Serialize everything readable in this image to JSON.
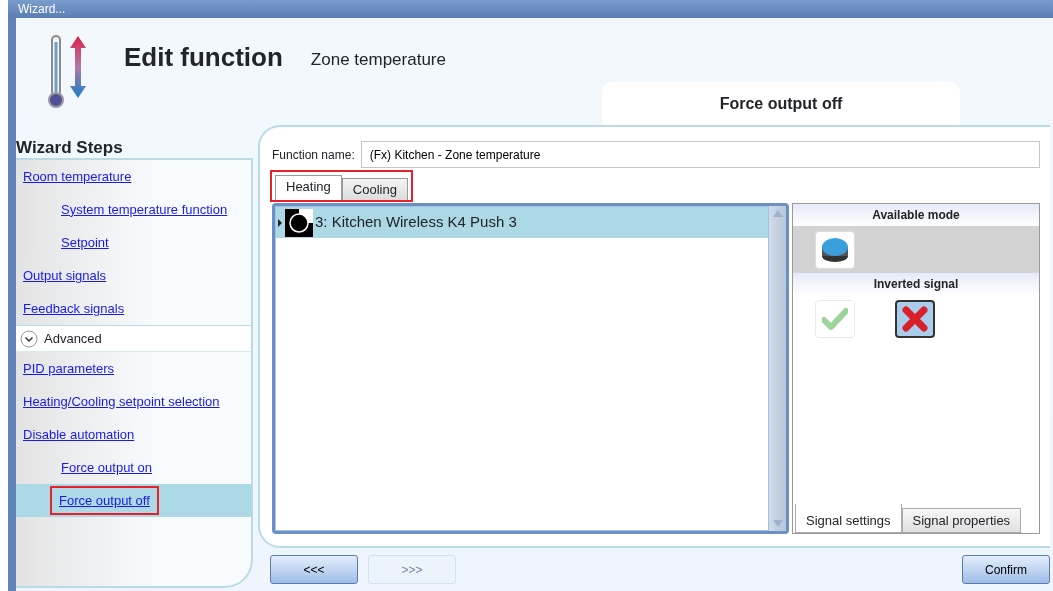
{
  "window": {
    "title": "Wizard..."
  },
  "header": {
    "title": "Edit function",
    "subtitle": "Zone temperature",
    "step_title": "Force output off"
  },
  "wizard_steps": {
    "heading": "Wizard Steps",
    "items": [
      {
        "label": "Room temperature",
        "selected": false,
        "children": [
          {
            "label": "System temperature function",
            "selected": false
          },
          {
            "label": "Setpoint",
            "selected": false
          }
        ]
      },
      {
        "label": "Output signals",
        "selected": false
      },
      {
        "label": "Feedback signals",
        "selected": false
      }
    ],
    "advanced": {
      "label": "Advanced",
      "expanded": true,
      "items": [
        {
          "label": "PID parameters",
          "selected": false
        },
        {
          "label": "Heating/Cooling setpoint selection",
          "selected": false
        },
        {
          "label": "Disable automation",
          "selected": false,
          "children": [
            {
              "label": "Force output on",
              "selected": false
            },
            {
              "label": "Force output off",
              "selected": true,
              "highlighted": true
            }
          ]
        }
      ]
    }
  },
  "function_name": {
    "label": "Function name:",
    "value": "(Fx) Kitchen - Zone temperature"
  },
  "tabs": {
    "highlighted": true,
    "items": [
      {
        "label": "Heating",
        "selected": true
      },
      {
        "label": "Cooling",
        "selected": false
      }
    ]
  },
  "signals": [
    {
      "label": "3: Kitchen Wireless K4 Push 3",
      "selected": true
    }
  ],
  "signal_panel": {
    "available_mode": {
      "heading": "Available mode",
      "options": [
        {
          "kind": "push-button",
          "selected": true
        }
      ]
    },
    "inverted_signal": {
      "heading": "Inverted signal",
      "options": [
        {
          "kind": "yes",
          "selected": false
        },
        {
          "kind": "no",
          "selected": true
        }
      ]
    },
    "tabs": [
      {
        "label": "Signal settings",
        "selected": true
      },
      {
        "label": "Signal properties",
        "selected": false
      }
    ]
  },
  "buttons": [
    {
      "kind": "back",
      "label": "<<<",
      "disabled": false
    },
    {
      "kind": "next",
      "label": ">>>",
      "disabled": true
    },
    {
      "kind": "confirm",
      "label": "Confirm",
      "disabled": false
    }
  ]
}
